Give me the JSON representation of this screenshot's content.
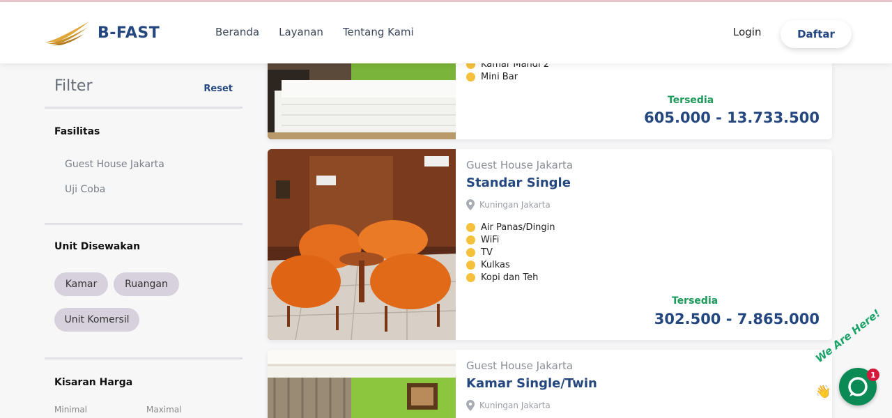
{
  "brand": {
    "name": "B-FAST"
  },
  "nav": {
    "items": [
      "Beranda",
      "Layanan",
      "Tentang Kami"
    ],
    "login": "Login",
    "register": "Daftar"
  },
  "sidebar": {
    "title": "Filter",
    "reset": "Reset",
    "fasilitas": {
      "title": "Fasilitas",
      "items": [
        "Guest House Jakarta",
        "Uji Coba"
      ]
    },
    "unit": {
      "title": "Unit Disewakan",
      "chips": [
        "Kamar",
        "Ruangan",
        "Unit Komersil"
      ]
    },
    "harga": {
      "title": "Kisaran Harga",
      "min_label": "Minimal",
      "max_label": "Maximal"
    }
  },
  "listings": [
    {
      "facilities": [
        "Kamar Mandi 2",
        "Mini Bar"
      ],
      "status": "Tersedia",
      "price": "605.000 - 13.733.500"
    },
    {
      "property": "Guest House Jakarta",
      "name": "Standar Single",
      "location": "Kuningan Jakarta",
      "facilities": [
        "Air Panas/Dingin",
        "WiFi",
        "TV",
        "Kulkas",
        "Kopi dan Teh"
      ],
      "status": "Tersedia",
      "price": "302.500 - 7.865.000"
    },
    {
      "property": "Guest House Jakarta",
      "name": "Kamar Single/Twin",
      "location": "Kuningan Jakarta"
    }
  ],
  "chat_widget": {
    "text": "We Are Here!",
    "badge": "1"
  },
  "colors": {
    "brand_blue": "#24477f",
    "available_green": "#1b9a59",
    "bullet_yellow": "#f5c13c",
    "chat_green": "#0c8a56"
  }
}
